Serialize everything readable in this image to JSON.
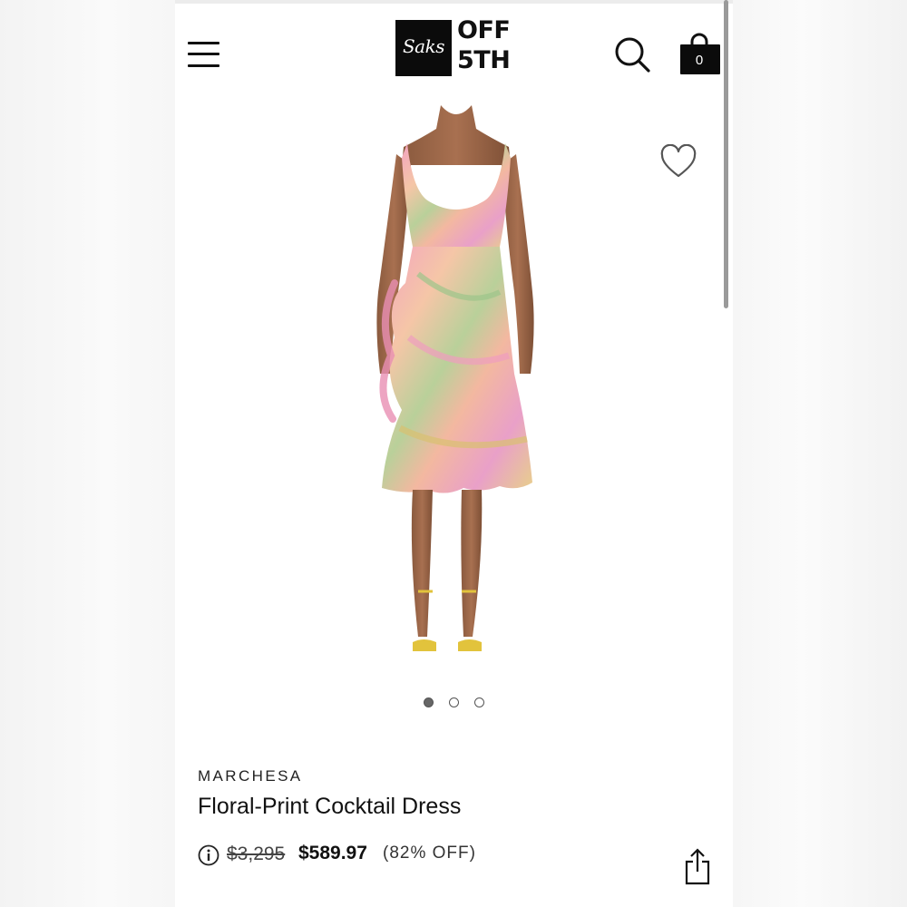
{
  "header": {
    "logo_script": "Saks",
    "logo_off": "OFF",
    "logo_fifth": "5TH",
    "bag_count": "0",
    "icons": {
      "menu": "hamburger-menu-icon",
      "search": "search-icon",
      "bag": "shopping-bag-icon"
    }
  },
  "gallery": {
    "wishlist_icon": "heart-outline-icon",
    "total_images": 3,
    "active_index": 0
  },
  "product": {
    "brand": "MARCHESA",
    "name": "Floral-Print Cocktail Dress",
    "original_price": "$3,295",
    "sale_price": "$589.97",
    "discount": "(82% OFF)"
  },
  "actions": {
    "share_icon": "share-icon",
    "info_icon": "info-icon"
  },
  "colors": {
    "brand_black": "#0b0b0b",
    "text": "#111111"
  }
}
